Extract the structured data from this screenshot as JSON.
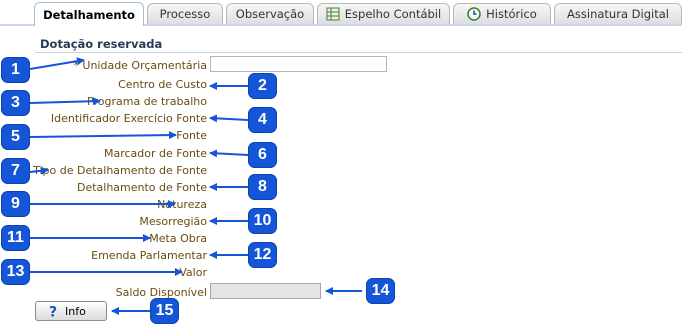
{
  "tabs": [
    {
      "label": "Detalhamento",
      "active": true,
      "icon": null
    },
    {
      "label": "Processo",
      "active": false,
      "icon": null
    },
    {
      "label": "Observação",
      "active": false,
      "icon": null
    },
    {
      "label": "Espelho Contábil",
      "active": false,
      "icon": "spreadsheet-icon"
    },
    {
      "label": "Histórico",
      "active": false,
      "icon": "history-icon"
    },
    {
      "label": "Assinatura Digital",
      "active": false,
      "icon": null
    }
  ],
  "section_title": "Dotação reservada",
  "fields": [
    {
      "label": "* Unidade Orçamentária",
      "badge": "1",
      "value": ""
    },
    {
      "label": "Centro de Custo",
      "badge": "2"
    },
    {
      "label": "Programa de trabalho",
      "badge": "3"
    },
    {
      "label": "Identificador Exercício Fonte",
      "badge": "4"
    },
    {
      "label": "Fonte",
      "badge": "5"
    },
    {
      "label": "Marcador de Fonte",
      "badge": "6"
    },
    {
      "label": "Tipo de Detalhamento de Fonte",
      "badge": "7"
    },
    {
      "label": "Detalhamento de Fonte",
      "badge": "8"
    },
    {
      "label": "Natureza",
      "badge": "9"
    },
    {
      "label": "Mesorregião",
      "badge": "10"
    },
    {
      "label": "Meta Obra",
      "badge": "11"
    },
    {
      "label": "Emenda Parlamentar",
      "badge": "12"
    },
    {
      "label": "Valor",
      "badge": "13"
    },
    {
      "label": "Saldo Disponível",
      "badge": "14",
      "value": ""
    }
  ],
  "info_button": {
    "label": "Info",
    "badge": "15"
  },
  "colors": {
    "badge": "#1556d8",
    "label_text": "#6b4a12",
    "tab_border": "#c9d9ea"
  }
}
